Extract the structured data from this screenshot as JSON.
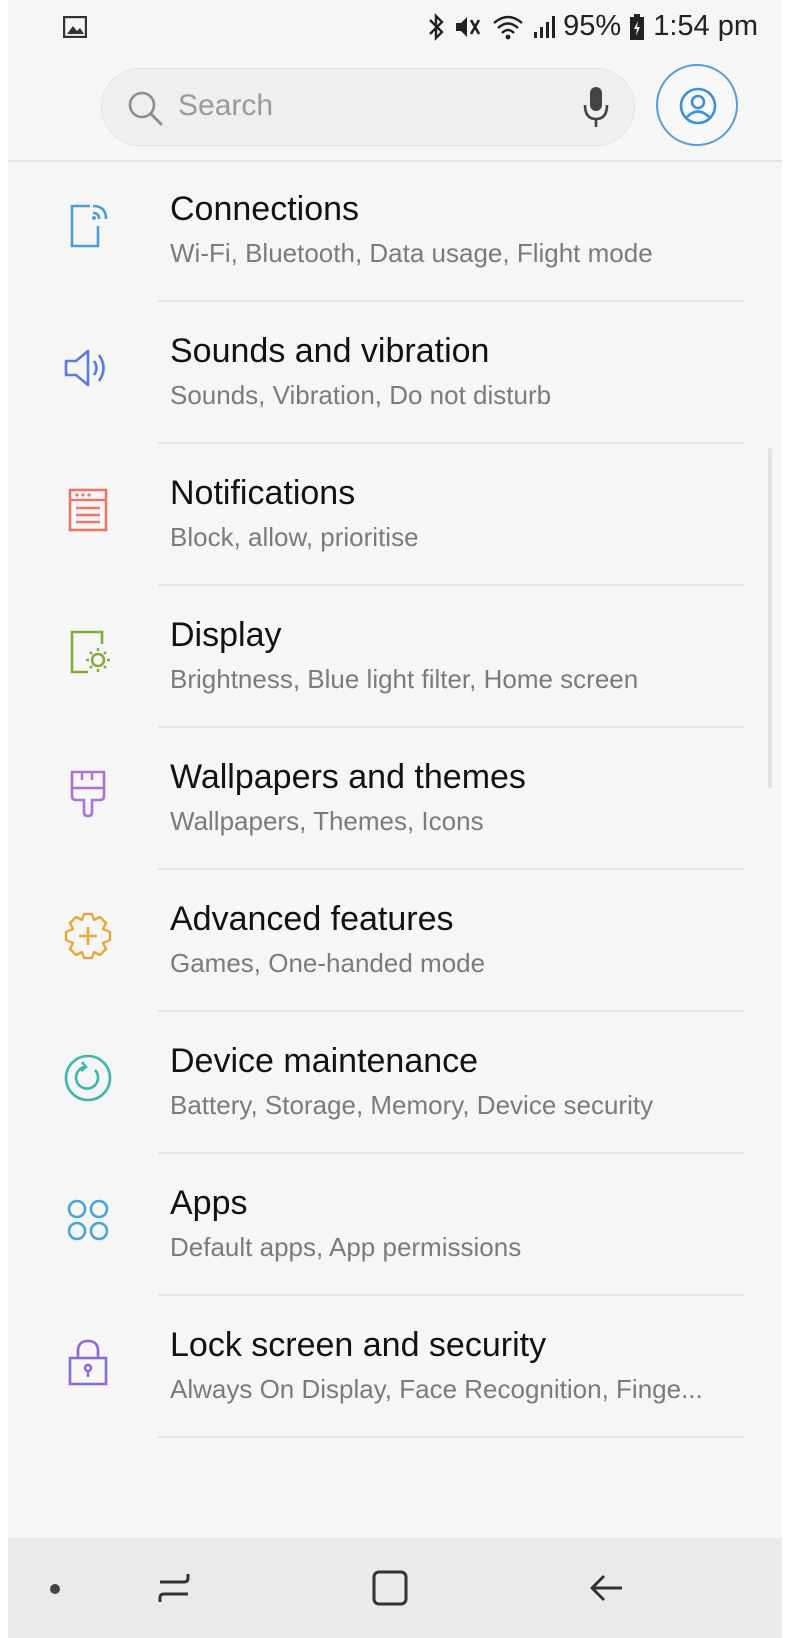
{
  "status_bar": {
    "battery": "95%",
    "time": "1:54 pm",
    "icons": [
      "gallery-icon",
      "bluetooth-icon",
      "mute-vibrate-icon",
      "wifi-icon",
      "signal-icon",
      "battery-icon"
    ]
  },
  "search": {
    "placeholder": "Search"
  },
  "settings": [
    {
      "title": "Connections",
      "subtitle": "Wi-Fi, Bluetooth, Data usage, Flight mode",
      "icon": "connections-icon",
      "color": "#4b9ed6"
    },
    {
      "title": "Sounds and vibration",
      "subtitle": "Sounds, Vibration, Do not disturb",
      "icon": "sound-icon",
      "color": "#5b7be0"
    },
    {
      "title": "Notifications",
      "subtitle": "Block, allow, prioritise",
      "icon": "notifications-icon",
      "color": "#e8786c"
    },
    {
      "title": "Display",
      "subtitle": "Brightness, Blue light filter, Home screen",
      "icon": "display-icon",
      "color": "#7fae3a"
    },
    {
      "title": "Wallpapers and themes",
      "subtitle": "Wallpapers, Themes, Icons",
      "icon": "paintbrush-icon",
      "color": "#b071d4"
    },
    {
      "title": "Advanced features",
      "subtitle": "Games, One-handed mode",
      "icon": "advanced-features-icon",
      "color": "#e6a83a"
    },
    {
      "title": "Device maintenance",
      "subtitle": "Battery, Storage, Memory, Device security",
      "icon": "device-maintenance-icon",
      "color": "#3fb6a8"
    },
    {
      "title": "Apps",
      "subtitle": "Default apps, App permissions",
      "icon": "apps-icon",
      "color": "#4aa3d8"
    },
    {
      "title": "Lock screen and security",
      "subtitle": "Always On Display, Face Recognition, Finge...",
      "icon": "lock-icon",
      "color": "#8a6ad8"
    }
  ],
  "nav_bar": {
    "icons": [
      "nav-dot-icon",
      "recent-apps-icon",
      "home-icon",
      "back-icon"
    ]
  }
}
